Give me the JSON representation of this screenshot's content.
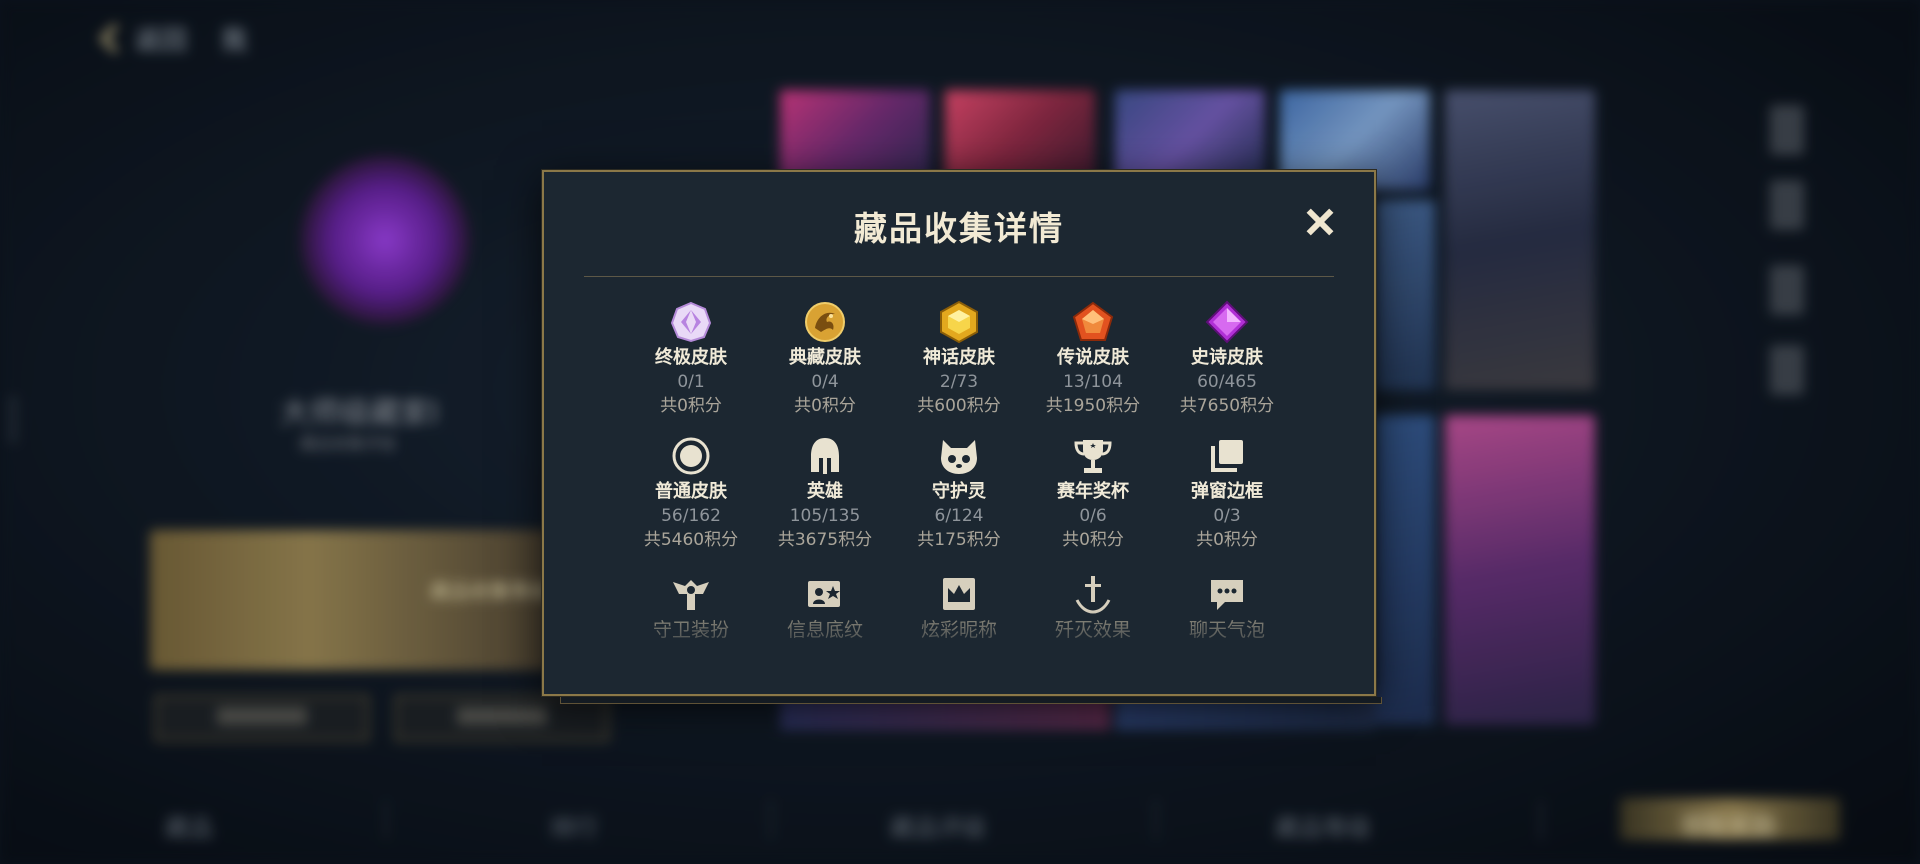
{
  "background": {
    "back_label": "返回",
    "header_text": "我",
    "player_name": "大师级藏家I",
    "player_sub": "藏品收集评级",
    "side_number": "3093942",
    "banner_text": "藏品收集等级",
    "bottom_nav": [
      "藏品",
      "排行",
      "藏品评级",
      "藏品等级",
      "领取奖励"
    ]
  },
  "modal": {
    "title": "藏品收集详情",
    "close_icon": "close-icon",
    "rows": [
      [
        {
          "icon": "ultimate-skin-icon",
          "name": "终极皮肤",
          "count": "0/1",
          "points": "共0积分"
        },
        {
          "icon": "treasure-skin-icon",
          "name": "典藏皮肤",
          "count": "0/4",
          "points": "共0积分"
        },
        {
          "icon": "myth-skin-icon",
          "name": "神话皮肤",
          "count": "2/73",
          "points": "共600积分"
        },
        {
          "icon": "legend-skin-icon",
          "name": "传说皮肤",
          "count": "13/104",
          "points": "共1950积分"
        },
        {
          "icon": "epic-skin-icon",
          "name": "史诗皮肤",
          "count": "60/465",
          "points": "共7650积分"
        }
      ],
      [
        {
          "icon": "normal-skin-icon",
          "name": "普通皮肤",
          "count": "56/162",
          "points": "共5460积分"
        },
        {
          "icon": "hero-helmet-icon",
          "name": "英雄",
          "count": "105/135",
          "points": "共3675积分"
        },
        {
          "icon": "guardian-spirit-icon",
          "name": "守护灵",
          "count": "6/124",
          "points": "共175积分"
        },
        {
          "icon": "trophy-icon",
          "name": "赛年奖杯",
          "count": "0/6",
          "points": "共0积分"
        },
        {
          "icon": "popup-frame-icon",
          "name": "弹窗边框",
          "count": "0/3",
          "points": "共0积分"
        }
      ],
      [
        {
          "icon": "guard-outfit-icon",
          "name": "守卫装扮"
        },
        {
          "icon": "info-pattern-icon",
          "name": "信息底纹"
        },
        {
          "icon": "crown-nickname-icon",
          "name": "炫彩昵称"
        },
        {
          "icon": "sword-effect-icon",
          "name": "歼灭效果"
        },
        {
          "icon": "chat-bubble-icon",
          "name": "聊天气泡"
        }
      ]
    ]
  }
}
